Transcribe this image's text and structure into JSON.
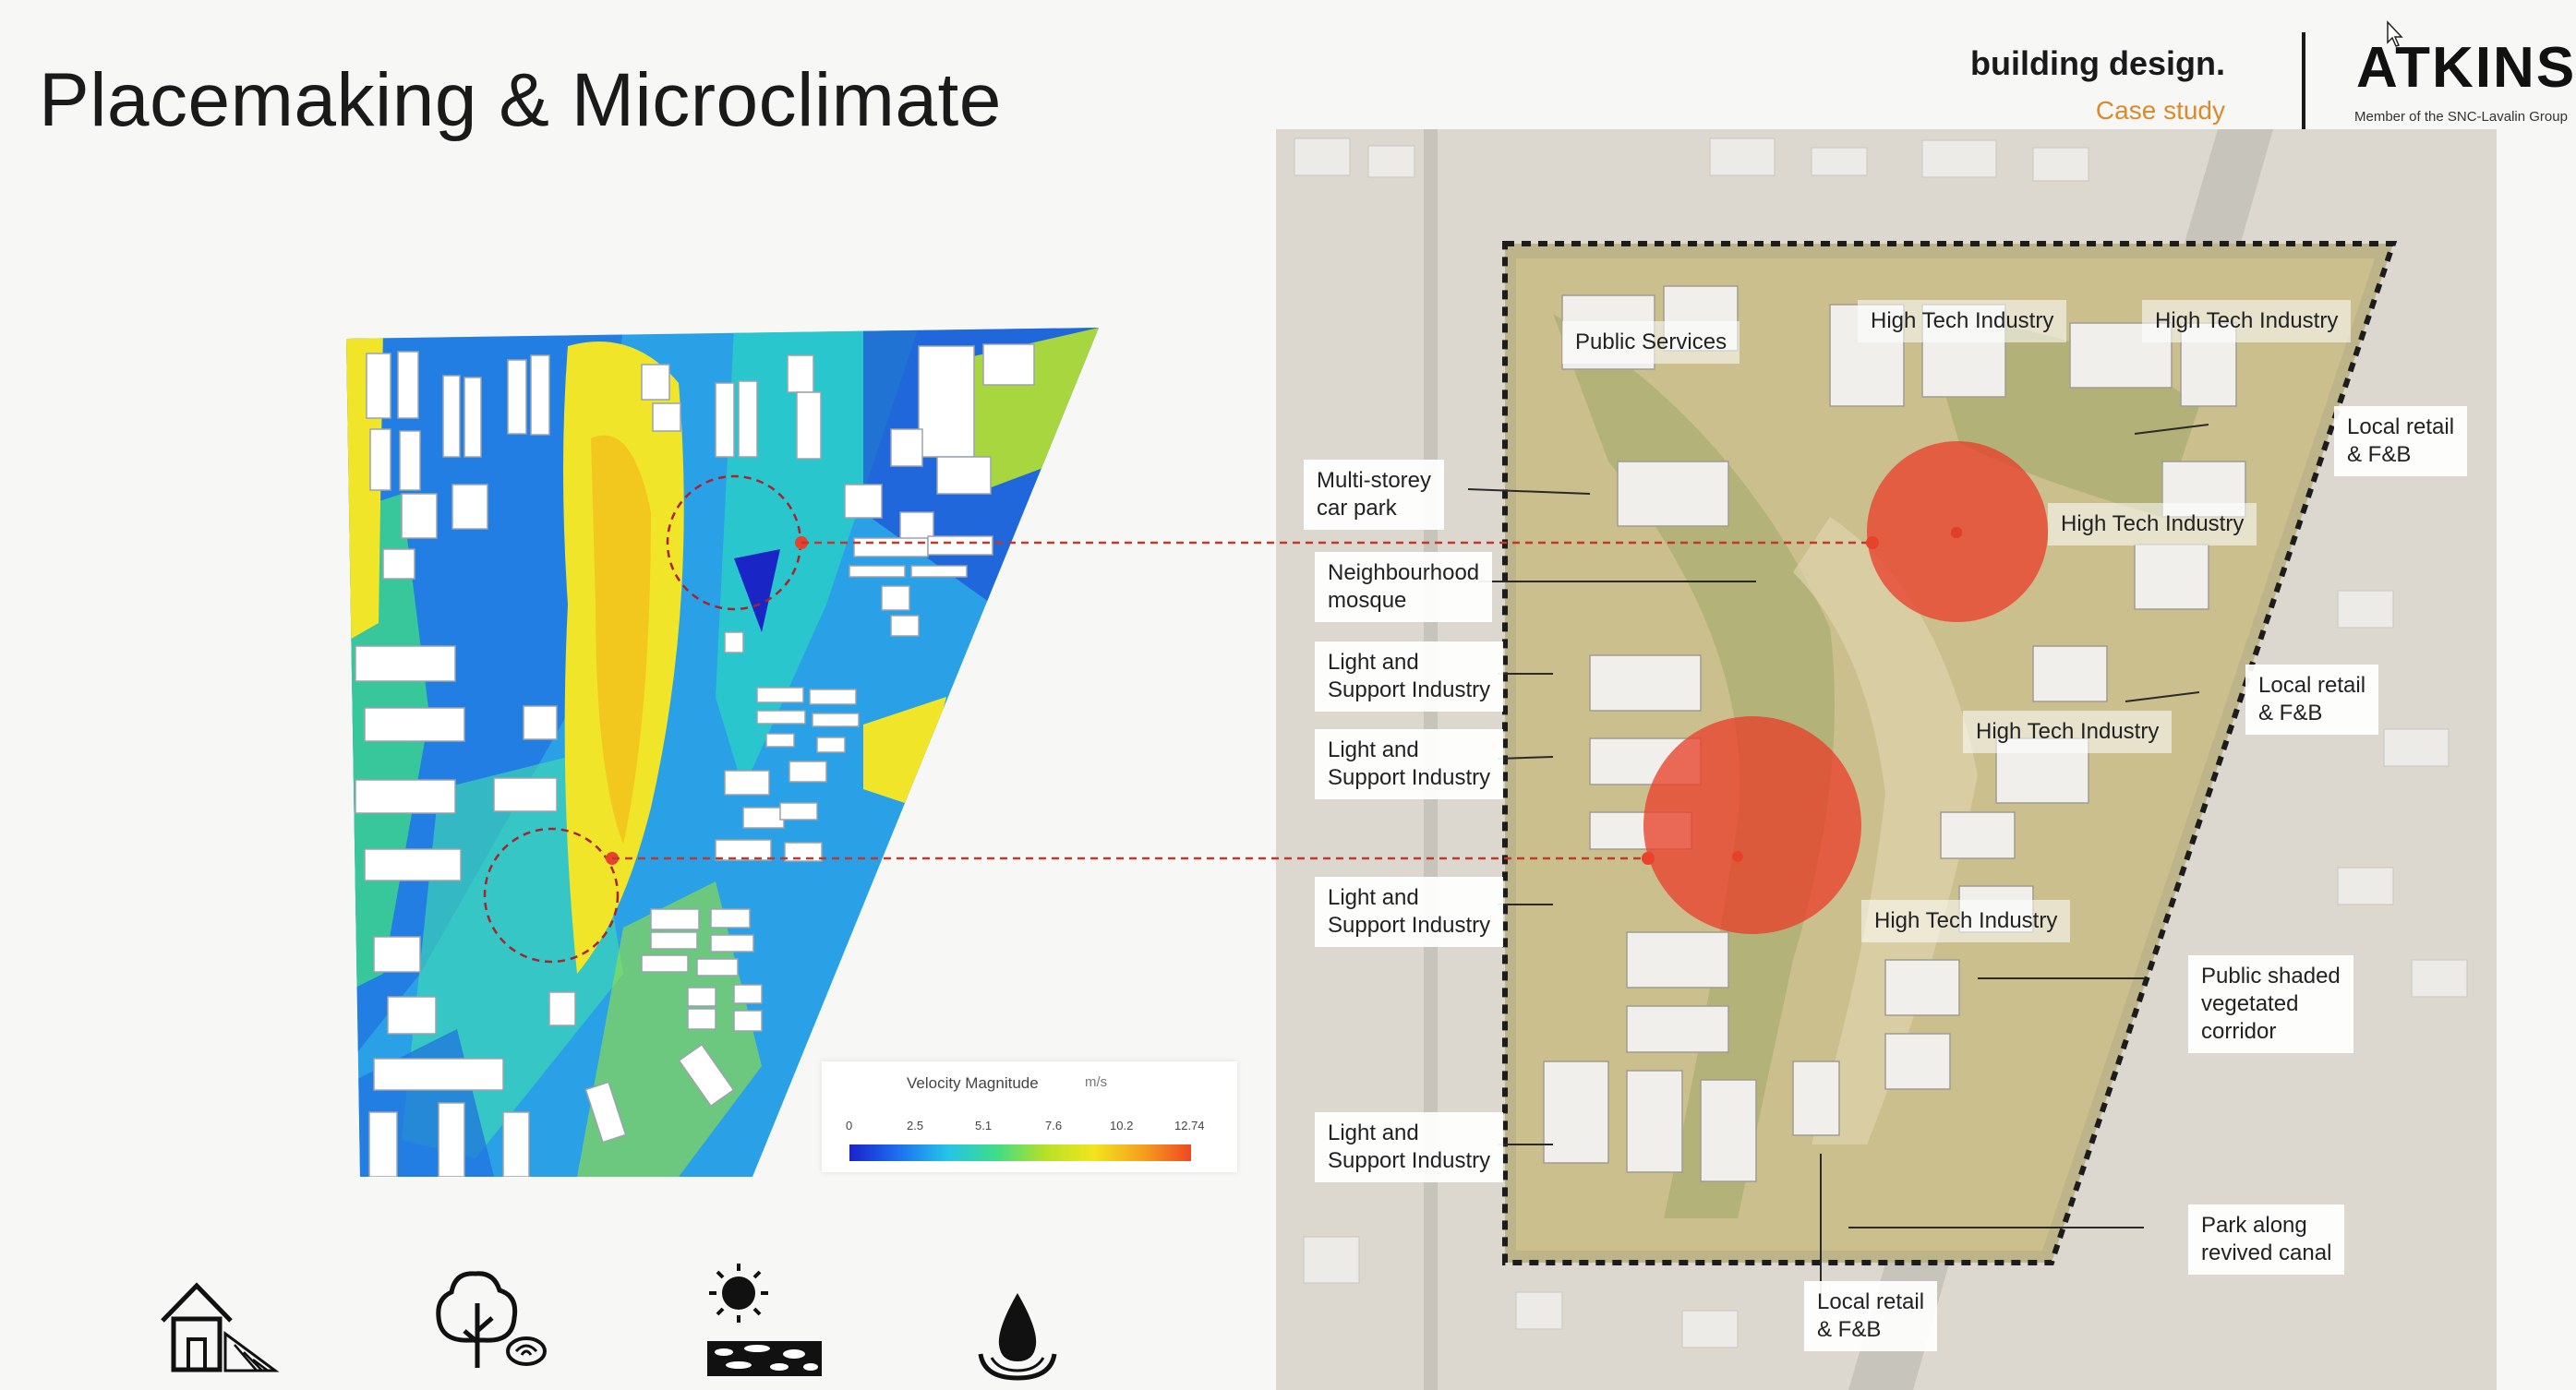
{
  "slide": {
    "title": "Placemaking & Microclimate",
    "brand_line1": "building design.",
    "brand_line2": "Case study",
    "logo_text": "ATKINS",
    "logo_sub": "Member of the SNC-Lavalin Group"
  },
  "legend": {
    "title": "Velocity Magnitude",
    "unit": "m/s",
    "ticks": [
      "0",
      "2.5",
      "5.1",
      "7.6",
      "10.2",
      "12.74"
    ]
  },
  "map_labels": {
    "public_services": "Public Services",
    "hti_1": "High Tech Industry",
    "hti_2": "High Tech Industry",
    "hti_3": "High Tech Industry",
    "hti_4": "High Tech Industry",
    "hti_5": "High Tech Industry",
    "local_retail_1_l1": "Local retail",
    "local_retail_1_l2": "& F&B",
    "local_retail_2_l1": "Local retail",
    "local_retail_2_l2": "& F&B",
    "local_retail_3_l1": "Local retail",
    "local_retail_3_l2": "& F&B",
    "car_park_l1": "Multi-storey",
    "car_park_l2": "car park",
    "mosque_l1": "Neighbourhood",
    "mosque_l2": "mosque",
    "lsi_1_l1": "Light and",
    "lsi_1_l2": "Support Industry",
    "lsi_2_l1": "Light and",
    "lsi_2_l2": "Support Industry",
    "lsi_3_l1": "Light and",
    "lsi_3_l2": "Support Industry",
    "lsi_4_l1": "Light and",
    "lsi_4_l2": "Support Industry",
    "corridor_l1": "Public shaded",
    "corridor_l2": "vegetated",
    "corridor_l3": "corridor",
    "canal_l1": "Park along",
    "canal_l2": "revived canal"
  },
  "icons": [
    "house-slope-icon",
    "tree-icon",
    "sun-ground-icon",
    "water-drop-icon"
  ],
  "colors": {
    "accent_orange": "#d98a2b",
    "highlight_red": "#e8412c",
    "dash_red": "#c0392b"
  }
}
